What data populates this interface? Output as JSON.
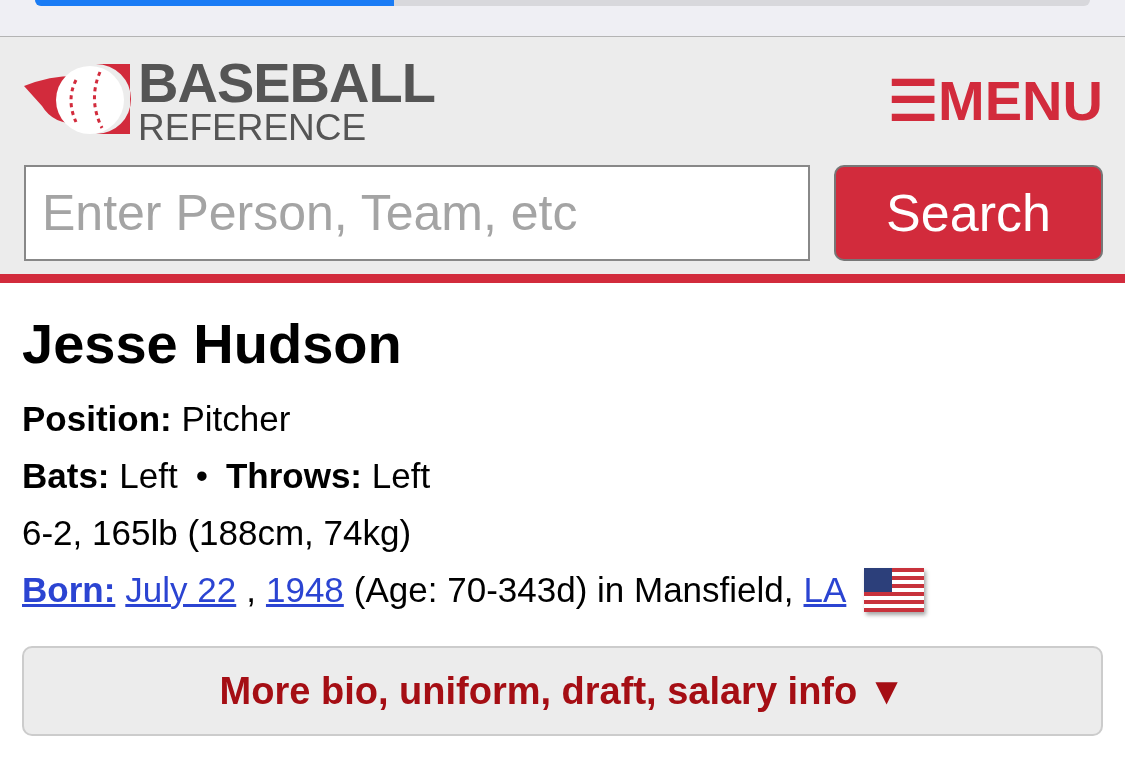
{
  "browser": {
    "progress": {
      "level": 0.34
    }
  },
  "header": {
    "logo": {
      "line1": "BASEBALL",
      "line2": "REFERENCE"
    },
    "menu": {
      "icon": "☰",
      "label": "MENU"
    }
  },
  "search": {
    "placeholder": "Enter Person, Team, etc",
    "button": "Search"
  },
  "player": {
    "name": "Jesse Hudson",
    "position": "**Position:** Pitcher",
    "bats": "**Bats:** Left",
    "separator": "•",
    "throws": "**Throws:** Left",
    "size": "6-2, 165lb (188cm, 74kg)",
    "born": {
      "label": "Born:",
      "date": "July 22",
      "comma": ",",
      "year": "1948",
      "rest": "(Age: 70-343d) in Mansfield,",
      "state": "LA"
    }
  },
  "more_button": {
    "label": "More bio, uniform, draft, salary info",
    "caret": "▼"
  }
}
